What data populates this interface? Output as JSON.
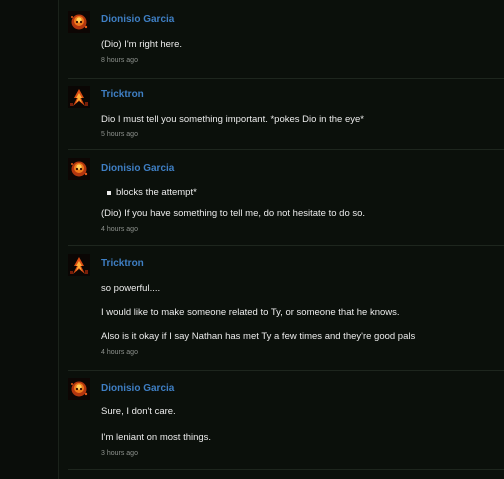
{
  "comments": [
    {
      "user": "Dionisio Garcia",
      "avatar": "flame-skull-avatar",
      "lines": [
        "(Dio) I'm right here."
      ],
      "time": "8 hours ago"
    },
    {
      "user": "Tricktron",
      "avatar": "flame-figure-avatar",
      "lines": [
        "Dio I must tell you something important. *pokes Dio in the eye*"
      ],
      "time": "5 hours ago"
    },
    {
      "user": "Dionisio Garcia",
      "avatar": "flame-skull-avatar",
      "bullet": "blocks the attempt*",
      "lines": [
        "(Dio) If you have something to tell me, do not hesitate to do so."
      ],
      "time": "4 hours ago"
    },
    {
      "user": "Tricktron",
      "avatar": "flame-figure-avatar",
      "lines": [
        "so powerful....",
        "I would like to make someone related to Ty, or someone that he knows.",
        "Also is it okay if I say Nathan has met Ty a few times and they're good pals"
      ],
      "time": "4 hours ago"
    },
    {
      "user": "Dionisio Garcia",
      "avatar": "flame-skull-avatar",
      "lines": [
        "Sure, I don't care.",
        "I'm leniant on most things."
      ],
      "time": "3 hours ago"
    }
  ],
  "colors": {
    "background": "#0b100b",
    "username": "#3f7fc4",
    "text": "#ececec",
    "timestamp": "#8d918d",
    "divider": "#1e261e"
  }
}
